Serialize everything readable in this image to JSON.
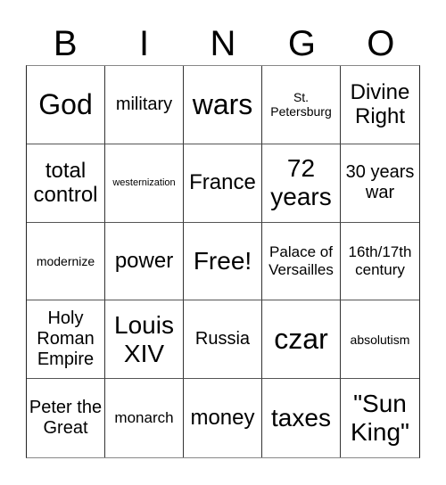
{
  "header": {
    "letters": [
      "B",
      "I",
      "N",
      "G",
      "O"
    ]
  },
  "card": {
    "rows": [
      [
        "God",
        "military",
        "wars",
        "St. Petersburg",
        "Divine Right"
      ],
      [
        "total control",
        "westernization",
        "France",
        "72 years",
        "30 years war"
      ],
      [
        "modernize",
        "power",
        "Free!",
        "Palace of Versailles",
        "16th/17th century"
      ],
      [
        "Holy Roman Empire",
        "Louis XIV",
        "Russia",
        "czar",
        "absolutism"
      ],
      [
        "Peter the Great",
        "monarch",
        "money",
        "taxes",
        "\"Sun King\""
      ]
    ]
  }
}
